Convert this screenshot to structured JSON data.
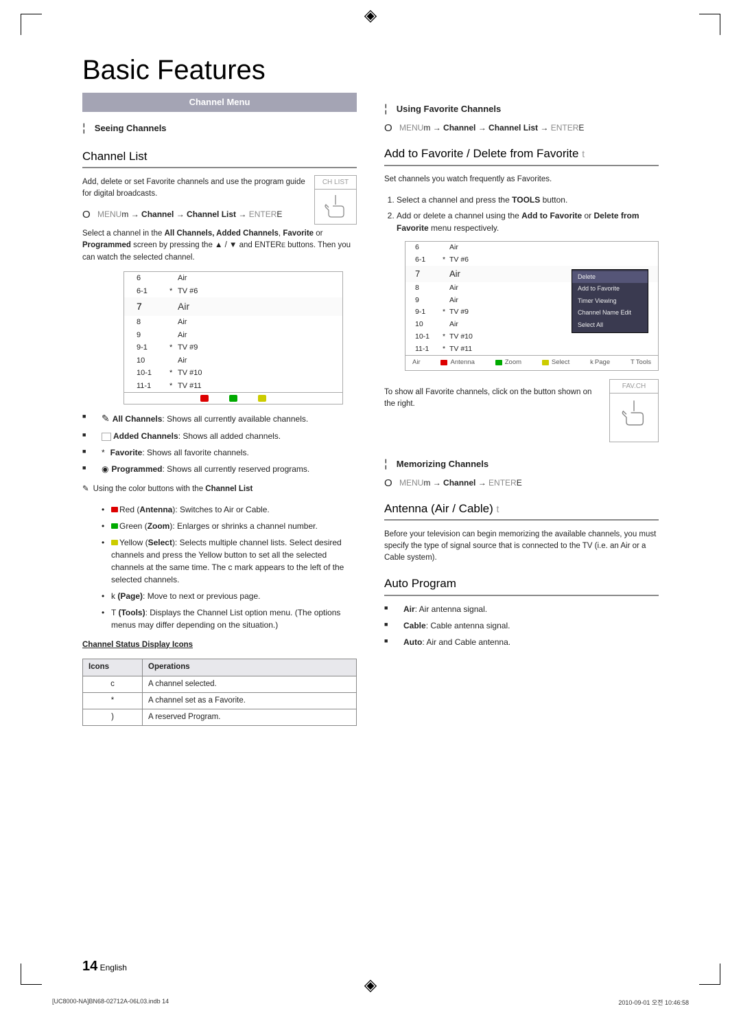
{
  "title": "Basic Features",
  "banner": "Channel Menu",
  "left": {
    "seeing_channels": "Seeing Channels",
    "channel_list": "Channel List",
    "channel_list_desc": "Add, delete or set Favorite channels and use the program guide for digital broadcasts.",
    "menu_path_1": "MENU",
    "menu_path_1_arrow": "m",
    "menu_path_1_mid": " → Channel → Channel List → ",
    "menu_path_1_end": "ENTER",
    "menu_path_1_end_icon": "E",
    "select_desc": "Select a channel in the All Channels, Added Channels, Favorite or Programmed screen by pressing the ▲ / ▼ and ENTERE   buttons. Then you can watch the selected channel.",
    "chlist_button_label": "CH LIST",
    "channels": [
      {
        "num": "6",
        "star": "",
        "name": "Air"
      },
      {
        "num": "6-1",
        "star": "*",
        "name": "TV #6"
      },
      {
        "num": "7",
        "star": "",
        "name": "Air",
        "highlight": true
      },
      {
        "num": "8",
        "star": "",
        "name": "Air"
      },
      {
        "num": "9",
        "star": "",
        "name": "Air"
      },
      {
        "num": "9-1",
        "star": "*",
        "name": "TV #9"
      },
      {
        "num": "10",
        "star": "",
        "name": "Air"
      },
      {
        "num": "10-1",
        "star": "*",
        "name": "TV #10"
      },
      {
        "num": "11-1",
        "star": "*",
        "name": "TV #11"
      }
    ],
    "bullets": [
      {
        "icon": "scribble",
        "bold": "All Channels",
        "rest": ": Shows all currently available channels."
      },
      {
        "icon": "added",
        "bold": "Added Channels",
        "rest": ": Shows all added channels."
      },
      {
        "icon": "star",
        "bold": "Favorite",
        "rest": ": Shows all favorite channels."
      },
      {
        "icon": "prog",
        "bold": "Programmed",
        "rest": ": Shows all currently reserved programs."
      }
    ],
    "color_note": "Using the color buttons with the Channel List",
    "color_bullets": [
      {
        "color": "red",
        "bold": "Red (Antenna)",
        "rest": ": Switches to Air or Cable."
      },
      {
        "color": "green",
        "bold": "Green (Zoom)",
        "rest": ": Enlarges or shrinks a channel number."
      },
      {
        "color": "yellow",
        "bold": "Yellow (Select)",
        "rest": ": Selects multiple channel lists. Select desired channels and press the Yellow button to set all the selected channels at the same time. The c   mark appears to the left of the selected channels."
      },
      {
        "prefix": "k",
        "bold": "(Page)",
        "rest": ": Move to next or previous page."
      },
      {
        "prefix": "T",
        "bold": "(Tools)",
        "rest": ": Displays the Channel List option menu. (The options menus may differ depending on the situation.)"
      }
    ],
    "status_heading": "Channel Status Display Icons",
    "table": {
      "h1": "Icons",
      "h2": "Operations",
      "rows": [
        {
          "icon": "c",
          "op": "A channel selected."
        },
        {
          "icon": "*",
          "op": "A channel set as a Favorite."
        },
        {
          "icon": ")",
          "op": "A reserved Program."
        }
      ]
    }
  },
  "right": {
    "using_fav": "Using Favorite Channels",
    "menu_path_2": " → Channel → Channel List → ",
    "add_fav_title": "Add to Favorite / Delete from Favorite",
    "add_fav_icon": "t",
    "set_desc": "Set channels you watch frequently as Favorites.",
    "step1": "Select a channel and press the TOOLS button.",
    "step2_pre": "Add or delete a channel using the ",
    "step2_b1": "Add to Favorite",
    "step2_mid": " or ",
    "step2_b2": "Delete from Favorite",
    "step2_end": " menu respectively.",
    "popup": {
      "items": [
        "Delete",
        "Add to Favorite",
        "Timer Viewing",
        "Channel Name Edit",
        "Select All"
      ]
    },
    "footer_labels": {
      "air": "Air",
      "antenna": "Antenna",
      "zoom": "Zoom",
      "select": "Select",
      "page_prefix": "k",
      "page": "Page",
      "tools_prefix": "T",
      "tools": "Tools"
    },
    "show_fav": "To show all Favorite channels, click on the button shown on the right.",
    "favch_label": "FAV.CH",
    "memorizing": "Memorizing Channels",
    "menu_path_3": " → Channel → ",
    "antenna_title": "Antenna (Air / Cable)",
    "antenna_icon": "t",
    "antenna_desc": "Before your television can begin memorizing the available channels, you must specify the type of signal source that is connected to the TV (i.e. an Air or a Cable system).",
    "auto_program": "Auto Program",
    "auto_bullets": [
      {
        "bold": "Air",
        "rest": ": Air antenna signal."
      },
      {
        "bold": "Cable",
        "rest": ": Cable antenna signal."
      },
      {
        "bold": "Auto",
        "rest": ": Air and Cable antenna."
      }
    ]
  },
  "pagefoot": {
    "num": "14",
    "lang": "English"
  },
  "printfoot": {
    "left": "[UC8000-NA]BN68-02712A-06L03.indb   14",
    "right": "2010-09-01   오전 10:46:58"
  }
}
